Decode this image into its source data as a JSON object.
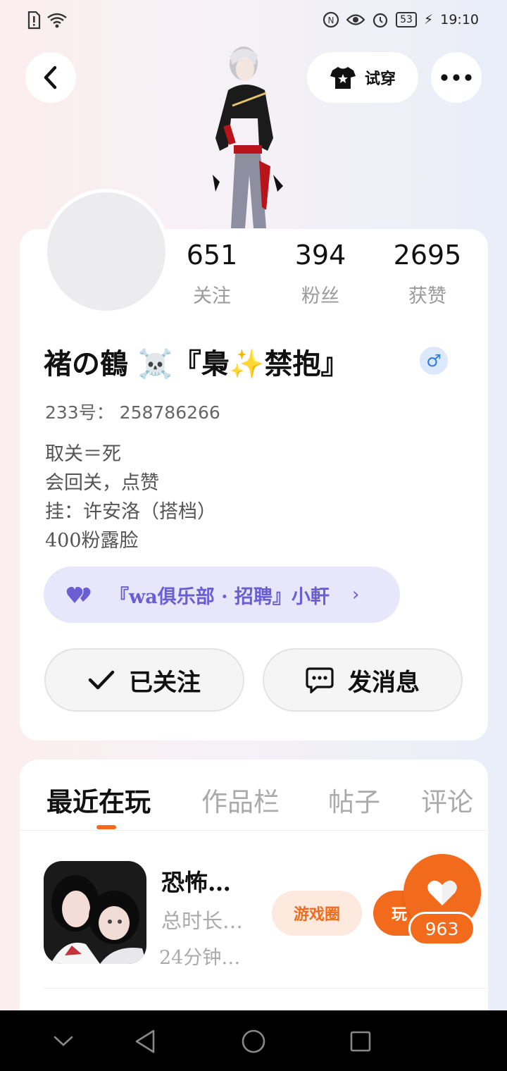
{
  "status_bar": {
    "time": "19:10",
    "battery": "53"
  },
  "header": {
    "try_on_label": "试穿"
  },
  "profile": {
    "stats": [
      {
        "value": "651",
        "label": "关注"
      },
      {
        "value": "394",
        "label": "粉丝"
      },
      {
        "value": "2695",
        "label": "获赞"
      }
    ],
    "username": "褚の鶴 ☠️『梟✨禁抱』",
    "gender_symbol": "♂",
    "uid_label": "233号：",
    "uid_value": "258786266",
    "bio": [
      "取关＝死",
      "会回关，点赞",
      "挂：许安洛（搭档）",
      "400粉露脸"
    ],
    "club": "『wa俱乐部 · 招聘』小軒",
    "follow_label": "已关注",
    "message_label": "发消息"
  },
  "tabs": [
    {
      "label": "最近在玩",
      "active": true
    },
    {
      "label": "作品栏",
      "active": false
    },
    {
      "label": "帖子",
      "active": false
    },
    {
      "label": "评论",
      "active": false
    }
  ],
  "recent_game": {
    "title": "恐怖…",
    "meta1": "总时长…",
    "meta2": "24分钟…",
    "circle_button": "游戏圈",
    "play_button": "玩"
  },
  "like_count": "963",
  "colors": {
    "accent": "#f26a1b",
    "club_text": "#6b5ed3",
    "club_bg": "#e8e6fb"
  },
  "icons": [
    "back-icon",
    "tshirt-icon",
    "more-icon",
    "heart-icon",
    "check-icon",
    "chat-icon",
    "nav-back-icon",
    "nav-home-icon",
    "nav-recent-icon"
  ]
}
